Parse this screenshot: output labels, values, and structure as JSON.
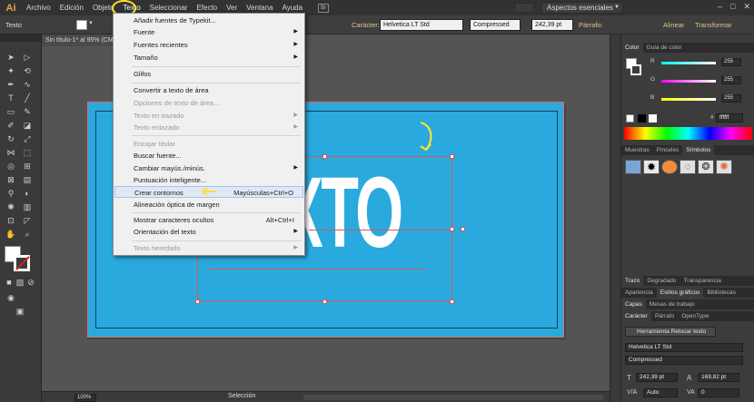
{
  "app": {
    "logo": "Ai",
    "menu": [
      "Archivo",
      "Edición",
      "Objeto",
      "Texto",
      "Seleccionar",
      "Efecto",
      "Ver",
      "Ventana",
      "Ayuda"
    ],
    "active_menu": "Texto",
    "br_label": "Br",
    "workspace": "Aspectos esenciales",
    "window_controls": [
      "–",
      "□",
      "✕"
    ]
  },
  "control_bar": {
    "tool_label": "Texto",
    "caracter_label": "Carácter:",
    "font_family": "Helvetica LT Std",
    "font_style": "Compressed",
    "font_size": "242,39 pt",
    "parrafo_label": "Párrafo:",
    "align_label": "Alinear",
    "transform_label": "Transformar"
  },
  "document": {
    "tab_title": "Sin título-1* al 95% (CMYK/Vista previa)",
    "art_text": "TEXTO",
    "artboard_color": "#2aa9de"
  },
  "dropdown": {
    "items": [
      {
        "label": "Añadir fuentes de Typekit...",
        "shortcut": "",
        "submenu": false,
        "disabled": false
      },
      {
        "label": "Fuente",
        "shortcut": "",
        "submenu": true,
        "disabled": false
      },
      {
        "label": "Fuentes recientes",
        "shortcut": "",
        "submenu": true,
        "disabled": false
      },
      {
        "label": "Tamaño",
        "shortcut": "",
        "submenu": true,
        "disabled": false
      },
      {
        "label": "Glifos",
        "shortcut": "",
        "submenu": false,
        "disabled": false
      },
      {
        "label": "Convertir a texto de área",
        "shortcut": "",
        "submenu": false,
        "disabled": false
      },
      {
        "label": "Opciones de texto de área...",
        "shortcut": "",
        "submenu": false,
        "disabled": true
      },
      {
        "label": "Texto en trazado",
        "shortcut": "",
        "submenu": true,
        "disabled": true
      },
      {
        "label": "Texto enlazado",
        "shortcut": "",
        "submenu": true,
        "disabled": true
      },
      {
        "label": "Encajar titular",
        "shortcut": "",
        "submenu": false,
        "disabled": true
      },
      {
        "label": "Buscar fuente...",
        "shortcut": "",
        "submenu": false,
        "disabled": false
      },
      {
        "label": "Cambiar mayús./minús.",
        "shortcut": "",
        "submenu": true,
        "disabled": false
      },
      {
        "label": "Puntuación inteligente...",
        "shortcut": "",
        "submenu": false,
        "disabled": false
      },
      {
        "label": "Crear contornos",
        "shortcut": "Mayúsculas+Ctrl+O",
        "submenu": false,
        "disabled": false,
        "highlighted": true
      },
      {
        "label": "Alineación óptica de margen",
        "shortcut": "",
        "submenu": false,
        "disabled": false
      },
      {
        "label": "Mostrar caracteres ocultos",
        "shortcut": "Alt+Ctrl+I",
        "submenu": false,
        "disabled": false
      },
      {
        "label": "Orientación del texto",
        "shortcut": "",
        "submenu": true,
        "disabled": false
      },
      {
        "label": "Texto heredado",
        "shortcut": "",
        "submenu": true,
        "disabled": true
      }
    ]
  },
  "color_panel": {
    "tabs": [
      "Color",
      "Guía de color"
    ],
    "channels": [
      {
        "label": "R",
        "value": "255"
      },
      {
        "label": "G",
        "value": "255"
      },
      {
        "label": "B",
        "value": "255"
      }
    ],
    "hex_label": "#",
    "hex_value": "ffffff"
  },
  "swatch_panel": {
    "tabs": [
      "Muestras",
      "Pinceles",
      "Símbolos"
    ]
  },
  "stroke_panel": {
    "tabs": [
      "Trazo",
      "Degradado",
      "Transparencia"
    ]
  },
  "appearance_panel": {
    "tabs": [
      "Apariencia",
      "Estilos gráficos",
      "Bibliotecas"
    ]
  },
  "layers_panel": {
    "tabs": [
      "Capas",
      "Mesas de trabajo"
    ]
  },
  "character_panel": {
    "tabs": [
      "Carácter",
      "Párrafo",
      "OpenType"
    ],
    "touch_tool": "Herramienta Retocar texto",
    "font_family": "Helvetica LT Std",
    "font_style": "Compressed",
    "font_size": "242,39 pt",
    "leading": "169,82 pt",
    "kerning": "Auto",
    "tracking": "0"
  },
  "status": {
    "zoom": "100%",
    "tool": "Selección"
  },
  "colors": {
    "highlight_circle": "#ffe034",
    "annotation_arrow": "#ffe034",
    "selection": "#d45a5a"
  }
}
